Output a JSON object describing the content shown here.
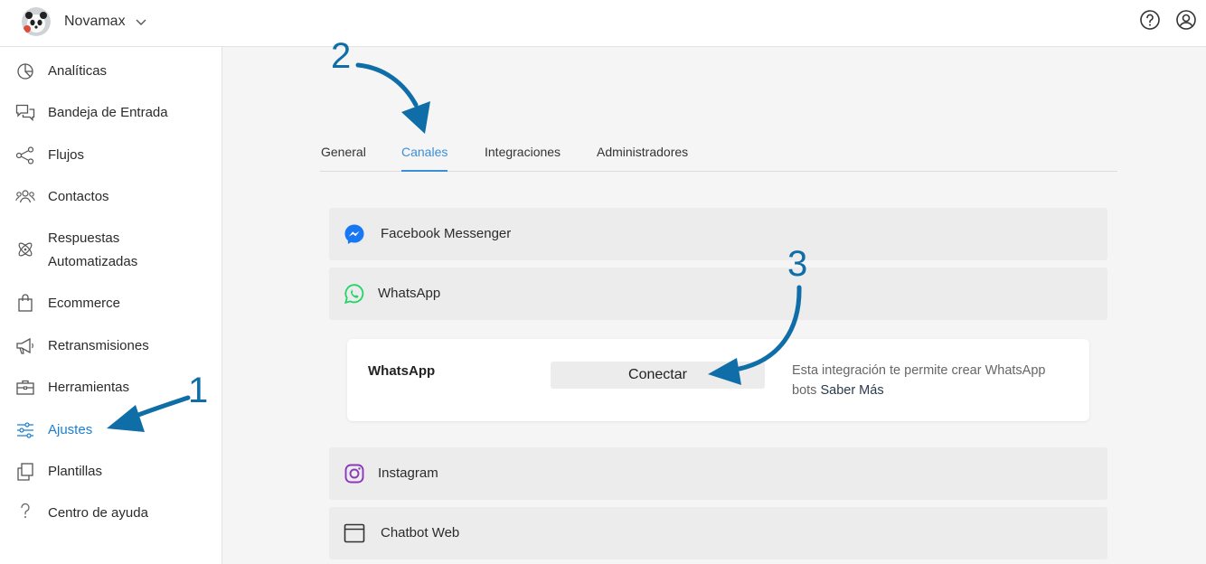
{
  "header": {
    "brand_name": "Novamax",
    "avatar_icon": "panda-logo",
    "help_icon": "help-circle-icon",
    "account_icon": "user-circle-icon"
  },
  "sidebar": {
    "items": [
      {
        "label": "Analíticas",
        "icon": "pie-chart-icon"
      },
      {
        "label": "Bandeja de Entrada",
        "icon": "chat-bubbles-icon"
      },
      {
        "label": "Flujos",
        "icon": "flow-icon"
      },
      {
        "label": "Contactos",
        "icon": "users-icon"
      },
      {
        "label": "Respuestas",
        "label2": "Automatizadas",
        "icon": "atom-icon"
      },
      {
        "label": "Ecommerce",
        "icon": "shopping-bag-icon"
      },
      {
        "label": "Retransmisiones",
        "icon": "megaphone-icon"
      },
      {
        "label": "Herramientas",
        "icon": "toolbox-icon"
      },
      {
        "label": "Ajustes",
        "icon": "sliders-icon",
        "active": true
      },
      {
        "label": "Plantillas",
        "icon": "copy-icon"
      },
      {
        "label": "Centro de ayuda",
        "icon": "question-icon"
      }
    ]
  },
  "tabs": [
    {
      "label": "General"
    },
    {
      "label": "Canales",
      "active": true
    },
    {
      "label": "Integraciones"
    },
    {
      "label": "Administradores"
    }
  ],
  "channels": [
    {
      "label": "Facebook Messenger",
      "icon": "messenger-icon"
    },
    {
      "label": "WhatsApp",
      "icon": "whatsapp-icon"
    },
    {
      "label": "Instagram",
      "icon": "instagram-icon"
    },
    {
      "label": "Chatbot Web",
      "icon": "browser-window-icon"
    }
  ],
  "whatsapp_card": {
    "title": "WhatsApp",
    "connect_label": "Conectar",
    "description": "Esta integración te permite crear WhatsApp bots",
    "link_label": "Saber Más"
  },
  "annotations": {
    "step1": "1",
    "step2": "2",
    "step3": "3"
  },
  "colors": {
    "accent": "#1a7fd4",
    "tab_active": "#3a8fd8",
    "arrow": "#0f6ea8",
    "messenger": "#1877f2",
    "whatsapp": "#25d366",
    "instagram": "#8a3ab9"
  }
}
